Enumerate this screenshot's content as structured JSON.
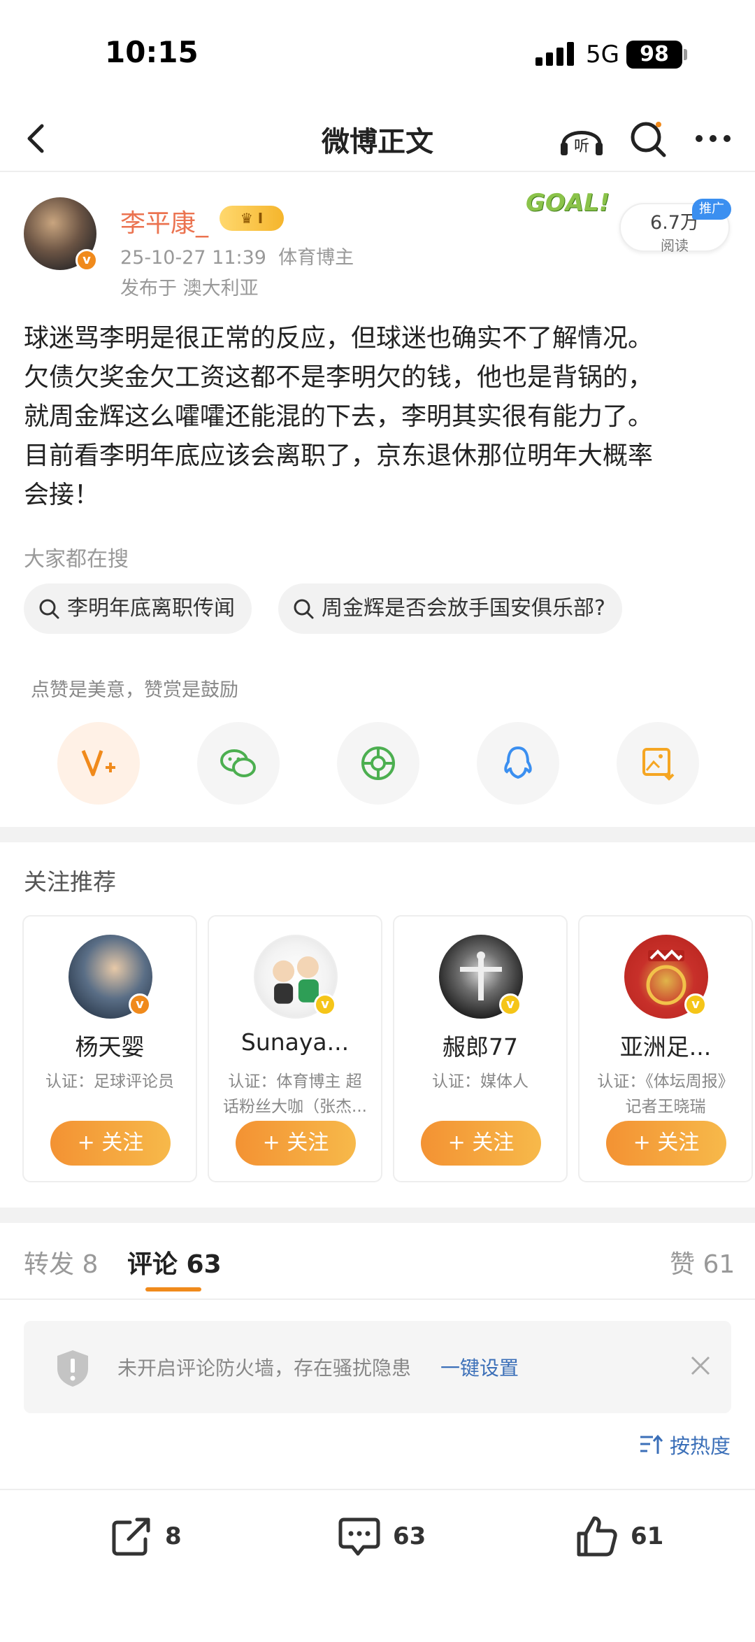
{
  "status_bar": {
    "time": "10:15",
    "network": "5G",
    "battery": "98"
  },
  "nav": {
    "title": "微博正文",
    "listen_label": "听"
  },
  "post": {
    "author": "李平康_",
    "vip_level": "I",
    "timestamp": "25-10-27 11:39",
    "author_tag": "体育博主",
    "location": "发布于 澳大利亚",
    "goal_badge": "GOAL!",
    "read_count": "6.7万",
    "read_label": "阅读",
    "ad_tag": "推广",
    "body_lines": [
      "球迷骂李明是很正常的反应，但球迷也确实不了解情况。",
      "欠债欠奖金欠工资这都不是李明欠的钱，他也是背锅的，",
      "就周金辉这么嚯嚯还能混的下去，李明其实很有能力了。",
      "目前看李明年底应该会离职了，京东退休那位明年大概率",
      "会接！"
    ]
  },
  "hot_search": {
    "label": "大家都在搜",
    "chips": [
      "李明年底离职传闻",
      "周金辉是否会放手国安俱乐部?"
    ]
  },
  "reward_hint": "点赞是美意，赞赏是鼓励",
  "share_icons": [
    "reward-icon",
    "wechat-icon",
    "moments-icon",
    "qq-icon",
    "save-image-icon"
  ],
  "recommend": {
    "title": "关注推荐",
    "follow_label": "+ 关注",
    "users": [
      {
        "name": "杨天婴",
        "desc": "认证：足球评论员"
      },
      {
        "name": "Sunaya...",
        "desc": "认证：体育博主 超话粉丝大咖（张杰..."
      },
      {
        "name": "赧郎77",
        "desc": "认证：媒体人"
      },
      {
        "name": "亚洲足...",
        "desc": "认证：《体坛周报》记者王晓瑞"
      }
    ]
  },
  "tabs": {
    "repost": "转发 8",
    "comment": "评论 63",
    "like": "赞 61"
  },
  "notice": {
    "text": "未开启评论防火墙，存在骚扰隐患",
    "link": "一键设置"
  },
  "sort_label": "按热度",
  "bottom_bar": {
    "repost_count": "8",
    "comment_count": "63",
    "like_count": "61"
  },
  "colors": {
    "accent": "#f08a1c",
    "link": "#3b6fb8",
    "author": "#eb7350"
  }
}
